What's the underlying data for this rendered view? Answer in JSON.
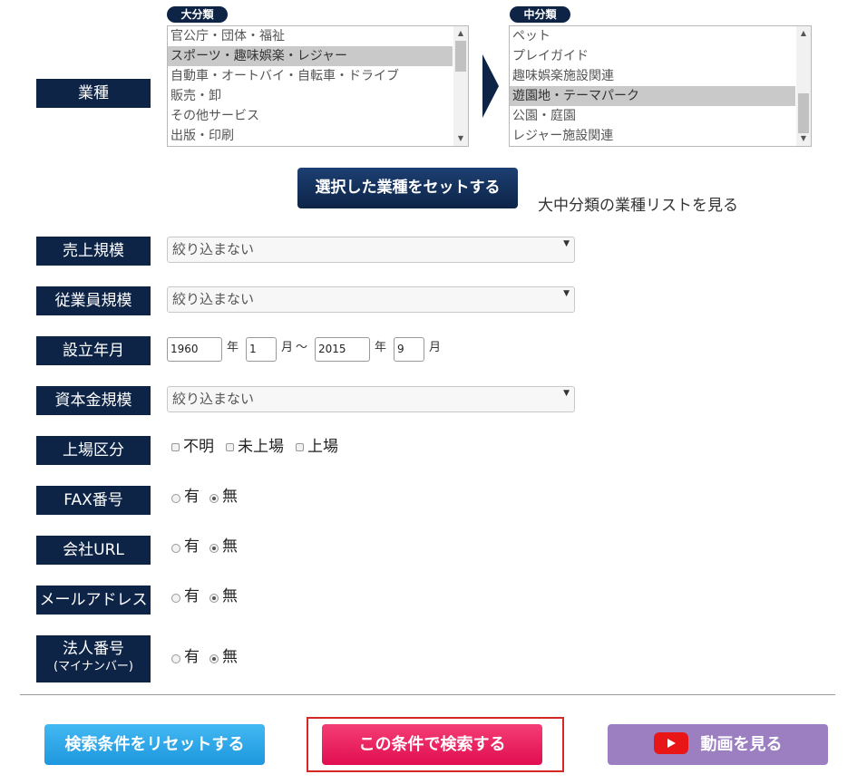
{
  "industry": {
    "label": "業種",
    "major": {
      "title": "大分類",
      "items": [
        "官公庁・団体・福祉",
        "スポーツ・趣味娯楽・レジャー",
        "自動車・オートバイ・自転車・ドライブ",
        "販売・卸",
        "その他サービス",
        "出版・印刷"
      ],
      "selected": "スポーツ・趣味娯楽・レジャー"
    },
    "middle": {
      "title": "中分類",
      "items": [
        "ペット",
        "プレイガイド",
        "趣味娯楽施設関連",
        "遊園地・テーマパーク",
        "公園・庭園",
        "レジャー施設関連"
      ],
      "selected": "遊園地・テーマパーク"
    },
    "set_button": "選択した業種をセットする",
    "list_link": "大中分類の業種リストを見る"
  },
  "sales": {
    "label": "売上規模",
    "value": "絞り込まない"
  },
  "employees": {
    "label": "従業員規模",
    "value": "絞り込まない"
  },
  "established": {
    "label": "設立年月",
    "from_year": "1960",
    "year_unit": "年",
    "from_month": "1",
    "month_unit": "月",
    "tilde": "～",
    "to_year": "2015",
    "to_month": "9"
  },
  "capital": {
    "label": "資本金規模",
    "value": "絞り込まない"
  },
  "listing": {
    "label": "上場区分",
    "options": [
      {
        "label": "不明",
        "checked": false
      },
      {
        "label": "未上場",
        "checked": false
      },
      {
        "label": "上場",
        "checked": false
      }
    ]
  },
  "fax": {
    "label": "FAX番号",
    "yes": "有",
    "no": "無",
    "selected": "無"
  },
  "url": {
    "label": "会社URL",
    "yes": "有",
    "no": "無",
    "selected": "無"
  },
  "email": {
    "label": "メールアドレス",
    "yes": "有",
    "no": "無",
    "selected": "無"
  },
  "corp_number": {
    "label": "法人番号",
    "sub": "(マイナンバー)",
    "yes": "有",
    "no": "無",
    "selected": "無"
  },
  "actions": {
    "reset": "検索条件をリセットする",
    "search": "この条件で検索する",
    "video": "動画を見る"
  },
  "colors": {
    "label_bg": "#0d2447",
    "reset": "#1d97de",
    "search": "#e10d51",
    "video": "#9b7fc0",
    "highlight": "#d62727"
  }
}
